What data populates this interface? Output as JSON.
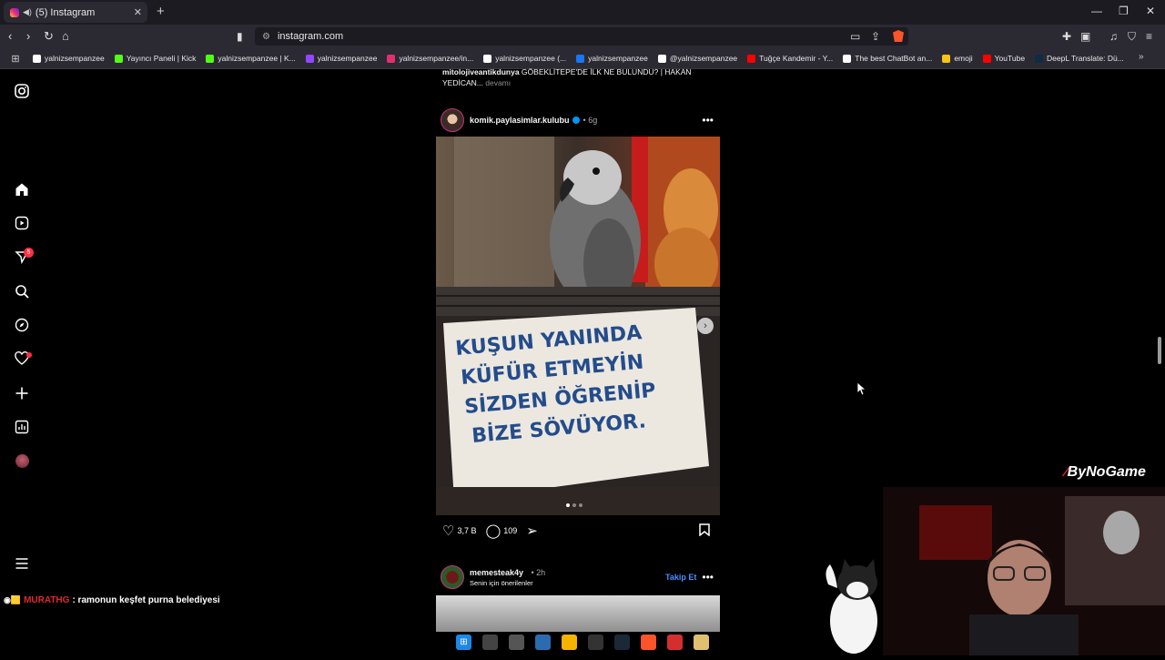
{
  "browser": {
    "tab_title": "(5) Instagram",
    "new_tab": "+",
    "url": "instagram.com",
    "bookmarks": [
      {
        "label": "yalnizsempanzee",
        "icon": "google-icon",
        "color": "#ffffff"
      },
      {
        "label": "Yayıncı Paneli | Kick",
        "icon": "kick-icon",
        "color": "#53fc18"
      },
      {
        "label": "yalnizsempanzee | K...",
        "icon": "kick-icon",
        "color": "#53fc18"
      },
      {
        "label": "yalnizsempanzee",
        "icon": "twitch-icon",
        "color": "#9146ff"
      },
      {
        "label": "yalnizsempanzee/in...",
        "icon": "instagram-icon",
        "color": "#e1306c"
      },
      {
        "label": "yalnizsempanzee (...",
        "icon": "tiktok-icon",
        "color": "#ffffff"
      },
      {
        "label": "yalnizsempanzee",
        "icon": "facebook-icon",
        "color": "#1877f2"
      },
      {
        "label": "@yalnizsempanzee",
        "icon": "x-icon",
        "color": "#ffffff"
      },
      {
        "label": "Tuğçe Kandemir - Y...",
        "icon": "youtube-icon",
        "color": "#ff0000"
      },
      {
        "label": "The best ChatBot an...",
        "icon": "chatbot-icon",
        "color": "#ffffff"
      },
      {
        "label": "emoji",
        "icon": "emoji-icon",
        "color": "#f5c518"
      },
      {
        "label": "YouTube",
        "icon": "youtube-icon",
        "color": "#ff0000"
      },
      {
        "label": "DeepL Translate: Dü...",
        "icon": "deepl-icon",
        "color": "#0f2b46"
      }
    ]
  },
  "sidebar": {
    "notifications_badge": "5"
  },
  "feed": {
    "prev_caption": {
      "user": "mitolojiveantikdunya",
      "text": "GÖBEKLİTEPE'DE İLK NE BULUNDU? | HAKAN YEDİCAN...",
      "more": "devamı"
    },
    "post": {
      "username": "komik.paylasimlar.kulubu",
      "time": "6g",
      "sign_text": [
        "KUŞUN YANINDA",
        "KÜFÜR ETMEYİN",
        "SİZDEN ÖĞRENİP",
        "BİZE SÖVÜYOR."
      ],
      "likes": "3,7 B",
      "comments": "109",
      "carousel_count": 3,
      "carousel_active": 1
    },
    "post2": {
      "username": "memesteak4y",
      "time": "2h",
      "subtitle": "Senin için önerilenler",
      "follow_label": "Takip Et"
    }
  },
  "overlay": {
    "chat_user": "MURATHG",
    "chat_message": ": ramonun keşfet purna belediyesi",
    "brand": "ByNoGame"
  },
  "colors": {
    "accent_blue": "#0095f6",
    "follow_blue": "#4e8cff",
    "notification_red": "#ff3040"
  }
}
